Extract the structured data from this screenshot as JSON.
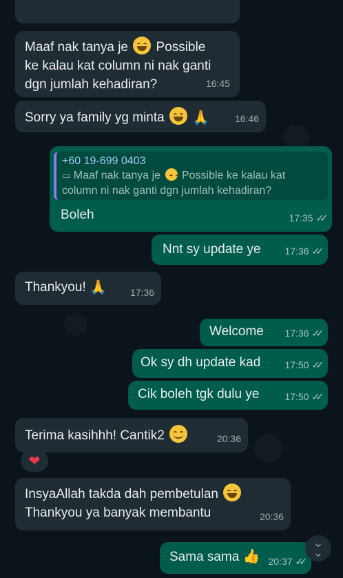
{
  "messages": [
    {
      "id": "m1",
      "text": "Maaf nak tanya je",
      "text2": "Possible\nke kalau kat column ni nak ganti\ndgn jumlah kehadiran?",
      "time": "16:45"
    },
    {
      "id": "m2",
      "text": "Sorry ya family yg minta",
      "time": "16:46"
    },
    {
      "id": "m3",
      "quote_sender": "+60 19-699 0403",
      "quote_text": "Maaf nak tanya je",
      "quote_text2": "Possible ke kalau kat column ni nak ganti dgn jumlah kehadiran?",
      "text": "Boleh",
      "time": "17:35"
    },
    {
      "id": "m4",
      "text": "Nnt sy update ye",
      "time": "17:36"
    },
    {
      "id": "m5",
      "text": "Thankyou!",
      "time": "17:36"
    },
    {
      "id": "m6",
      "text": "Welcome",
      "time": "17:36"
    },
    {
      "id": "m7",
      "text": "Ok sy dh update kad",
      "time": "17:50"
    },
    {
      "id": "m8",
      "text": "Cik boleh tgk dulu ye",
      "time": "17:50"
    },
    {
      "id": "m9",
      "text": "Terima kasihhh! Cantik2",
      "time": "20:36"
    },
    {
      "id": "m10",
      "text": "InsyaAllah takda dah pembetulan",
      "text2": "Thankyou ya banyak membantu",
      "time": "20:36"
    },
    {
      "id": "m11",
      "text": "Sama sama",
      "time": "20:37"
    }
  ],
  "reaction": {
    "emoji": "❤"
  },
  "icons": {
    "read_receipt": "double-check-icon",
    "scroll_down": "double-chevron-down-icon"
  },
  "colors": {
    "background": "#0b141a",
    "incoming": "#202c33",
    "outgoing": "#005c4b",
    "quote_bar": "#8a7cf5"
  }
}
